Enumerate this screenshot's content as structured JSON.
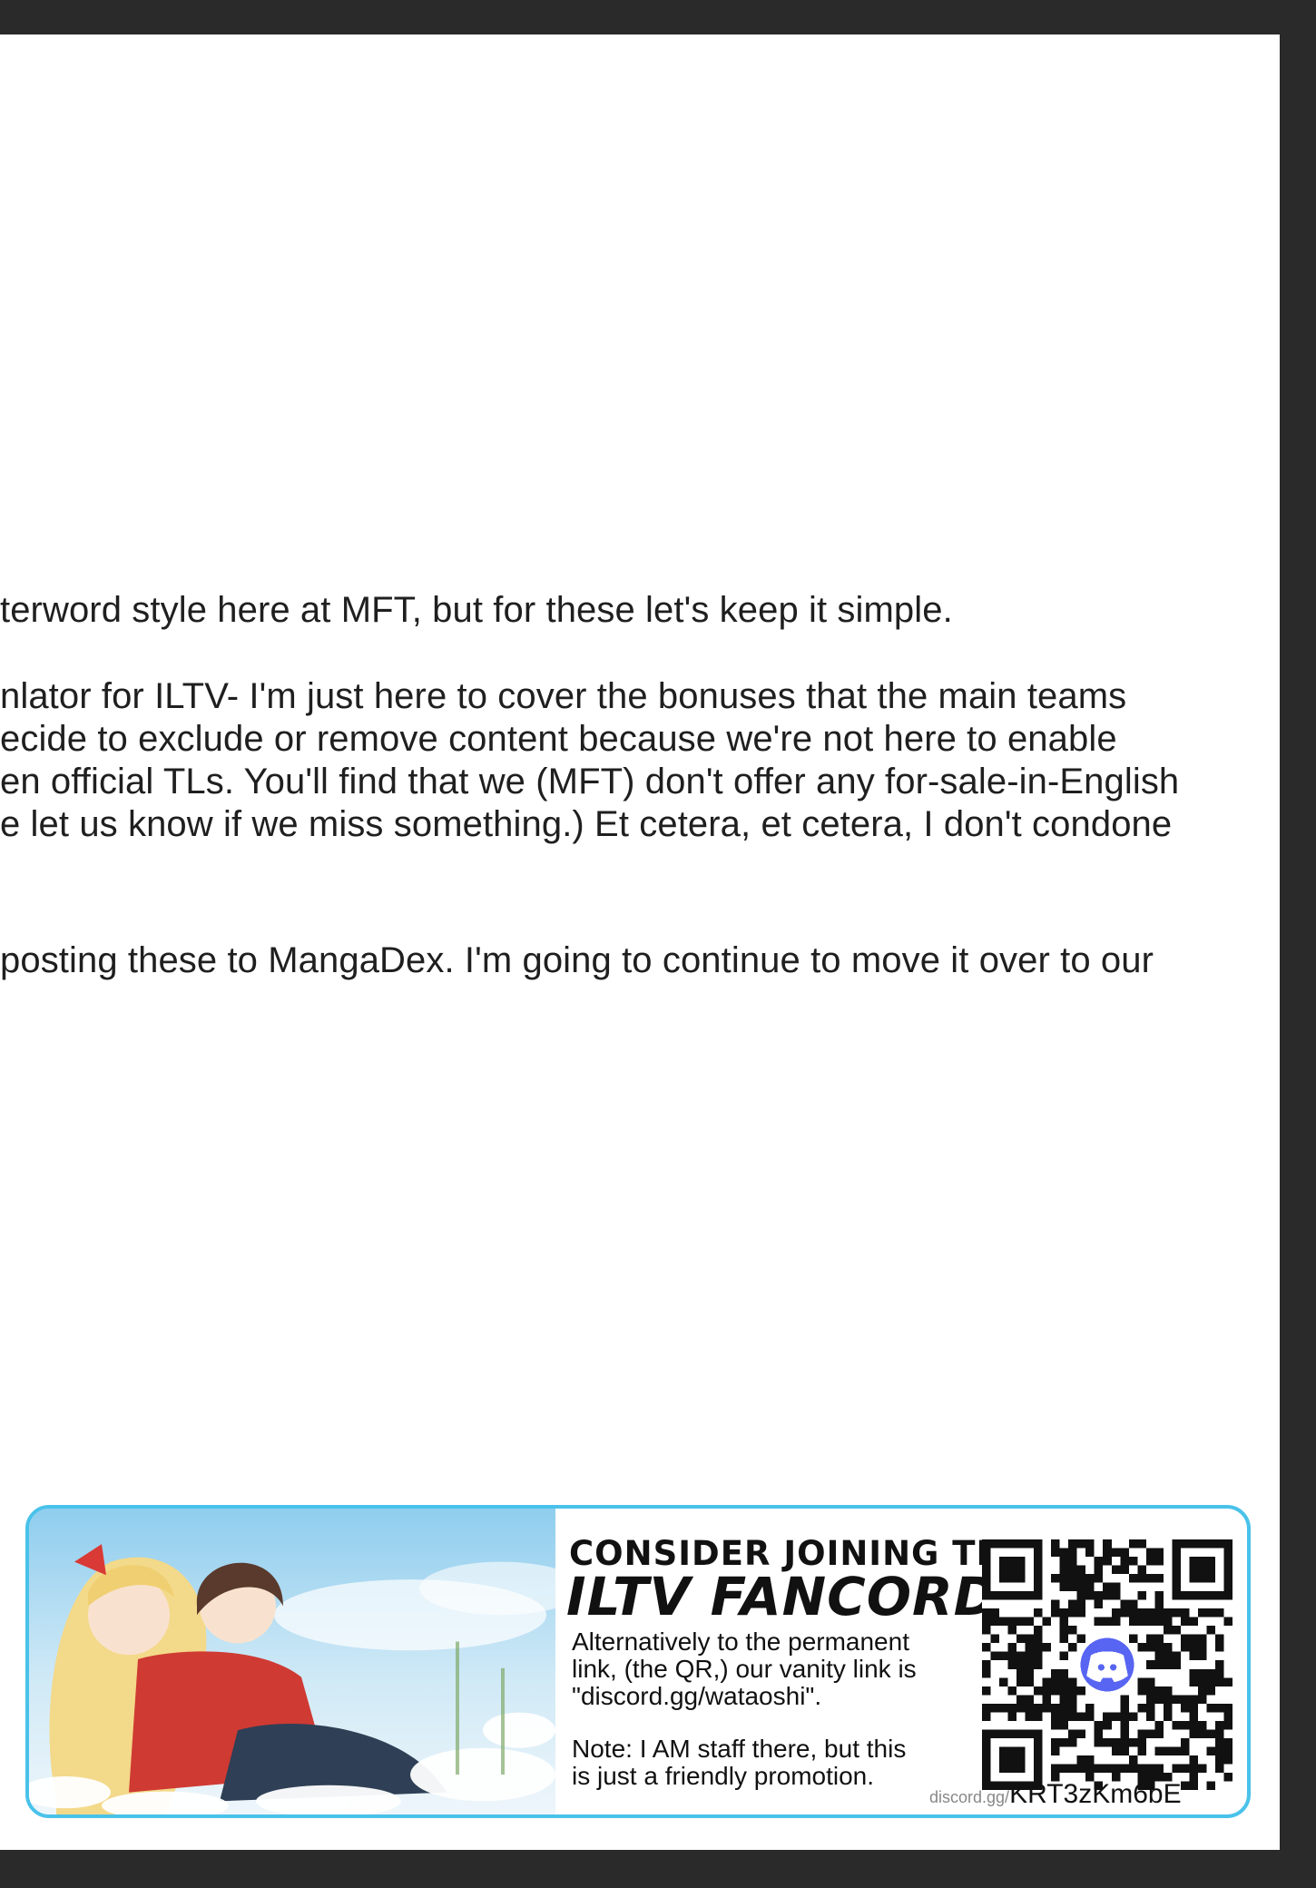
{
  "paragraphs": [
    "terword style here at MFT, but for these let's keep it simple.",
    "nlator for ILTV- I'm just here to cover the bonuses that the main teams",
    "ecide to exclude or remove content because we're not here to enable",
    "en official TLs. You'll find that we (MFT) don't offer any for-sale-in-English",
    "e let us know if we miss something.) Et cetera, et cetera, I don't condone",
    "posting these to MangaDex. I'm going to continue to move it over to our"
  ],
  "banner": {
    "headline_small": "CONSIDER JOINING THE",
    "headline_large": "ILTV FANCORD!",
    "body_1_line_1": "Alternatively to the permanent",
    "body_1_line_2": "link, (the QR,) our vanity link is",
    "body_1_line_3": "\"discord.gg/wataoshi\".",
    "body_2_line_1": "Note: I AM staff there, but this",
    "body_2_line_2": "is just a friendly promotion.",
    "link_prefix": "discord.gg/",
    "link_code": "KRT3zKm6bE",
    "accent_color": "#49c2ea",
    "discord_color": "#5865f2",
    "qr_icon": "discord-logo-icon",
    "art_subject": "anime-illustration"
  }
}
